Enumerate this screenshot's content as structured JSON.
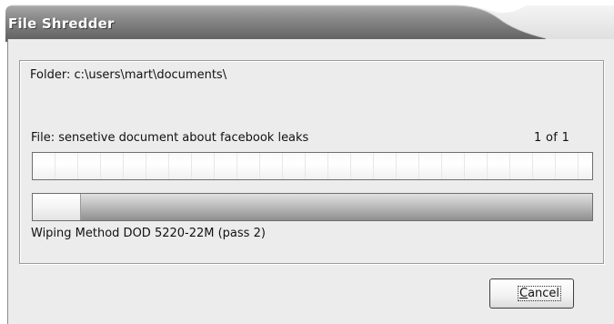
{
  "window": {
    "title": "File Shredder",
    "accent_color": "#6b6b6b"
  },
  "folder": {
    "text": "Folder: c:\\users\\mart\\documents\\"
  },
  "file": {
    "text": "File: sensetive document about facebook leaks",
    "count": "1  of  1",
    "progress": 0
  },
  "pass": {
    "progress": 0.085,
    "method_text": "Wiping Method DOD 5220-22M  (pass 2)"
  },
  "buttons": {
    "cancel": {
      "mnemonic": "C",
      "rest": "ancel"
    }
  }
}
